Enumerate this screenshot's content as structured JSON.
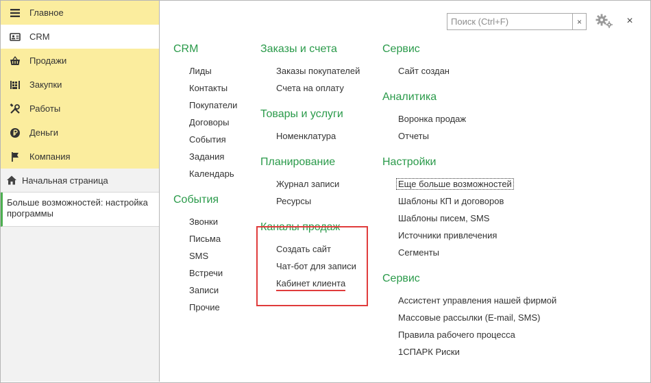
{
  "sidebar": {
    "sections": [
      {
        "label": "Главное",
        "icon": "hamburger-menu-icon"
      },
      {
        "label": "CRM",
        "icon": "contact-card-icon"
      },
      {
        "label": "Продажи",
        "icon": "shopping-basket-icon"
      },
      {
        "label": "Закупки",
        "icon": "warehouse-icon"
      },
      {
        "label": "Работы",
        "icon": "tools-icon"
      },
      {
        "label": "Деньги",
        "icon": "ruble-coin-icon"
      },
      {
        "label": "Компания",
        "icon": "flag-icon"
      }
    ],
    "active_section": "CRM",
    "home_label": "Начальная страница",
    "open_item_label": "Больше возможностей: настройка программы"
  },
  "search": {
    "placeholder": "Поиск (Ctrl+F)",
    "value": "",
    "clear_glyph": "×"
  },
  "window": {
    "close_glyph": "×"
  },
  "columns": {
    "col1": [
      {
        "title": "CRM",
        "links": [
          "Лиды",
          "Контакты",
          "Покупатели",
          "Договоры",
          "События",
          "Задания",
          "Календарь"
        ]
      },
      {
        "title": "События",
        "links": [
          "Звонки",
          "Письма",
          "SMS",
          "Встречи",
          "Записи",
          "Прочие"
        ]
      }
    ],
    "col2": [
      {
        "title": "Заказы и счета",
        "links": [
          "Заказы покупателей",
          "Счета на оплату"
        ]
      },
      {
        "title": "Товары и услуги",
        "links": [
          "Номенклатура"
        ]
      },
      {
        "title": "Планирование",
        "links": [
          "Журнал записи",
          "Ресурсы"
        ]
      },
      {
        "title": "Каналы продаж",
        "links": [
          "Создать сайт",
          "Чат-бот для записи",
          "Кабинет клиента"
        ]
      }
    ],
    "col3": [
      {
        "title": "Сервис",
        "links": [
          "Сайт создан"
        ]
      },
      {
        "title": "Аналитика",
        "links": [
          "Воронка продаж",
          "Отчеты"
        ]
      },
      {
        "title": "Настройки",
        "links": [
          "Еще больше возможностей",
          "Шаблоны КП и договоров",
          "Шаблоны писем, SMS",
          "Источники привлечения",
          "Сегменты"
        ]
      },
      {
        "title": "Сервис",
        "links": [
          "Ассистент управления нашей фирмой",
          "Массовые рассылки (E-mail, SMS)",
          "Правила рабочего процесса",
          "1СПАРК Риски"
        ]
      }
    ]
  },
  "colors": {
    "accent_green": "#2a9a4a",
    "sidebar_yellow": "#fbed9e",
    "highlight_red": "#e03b3b"
  }
}
